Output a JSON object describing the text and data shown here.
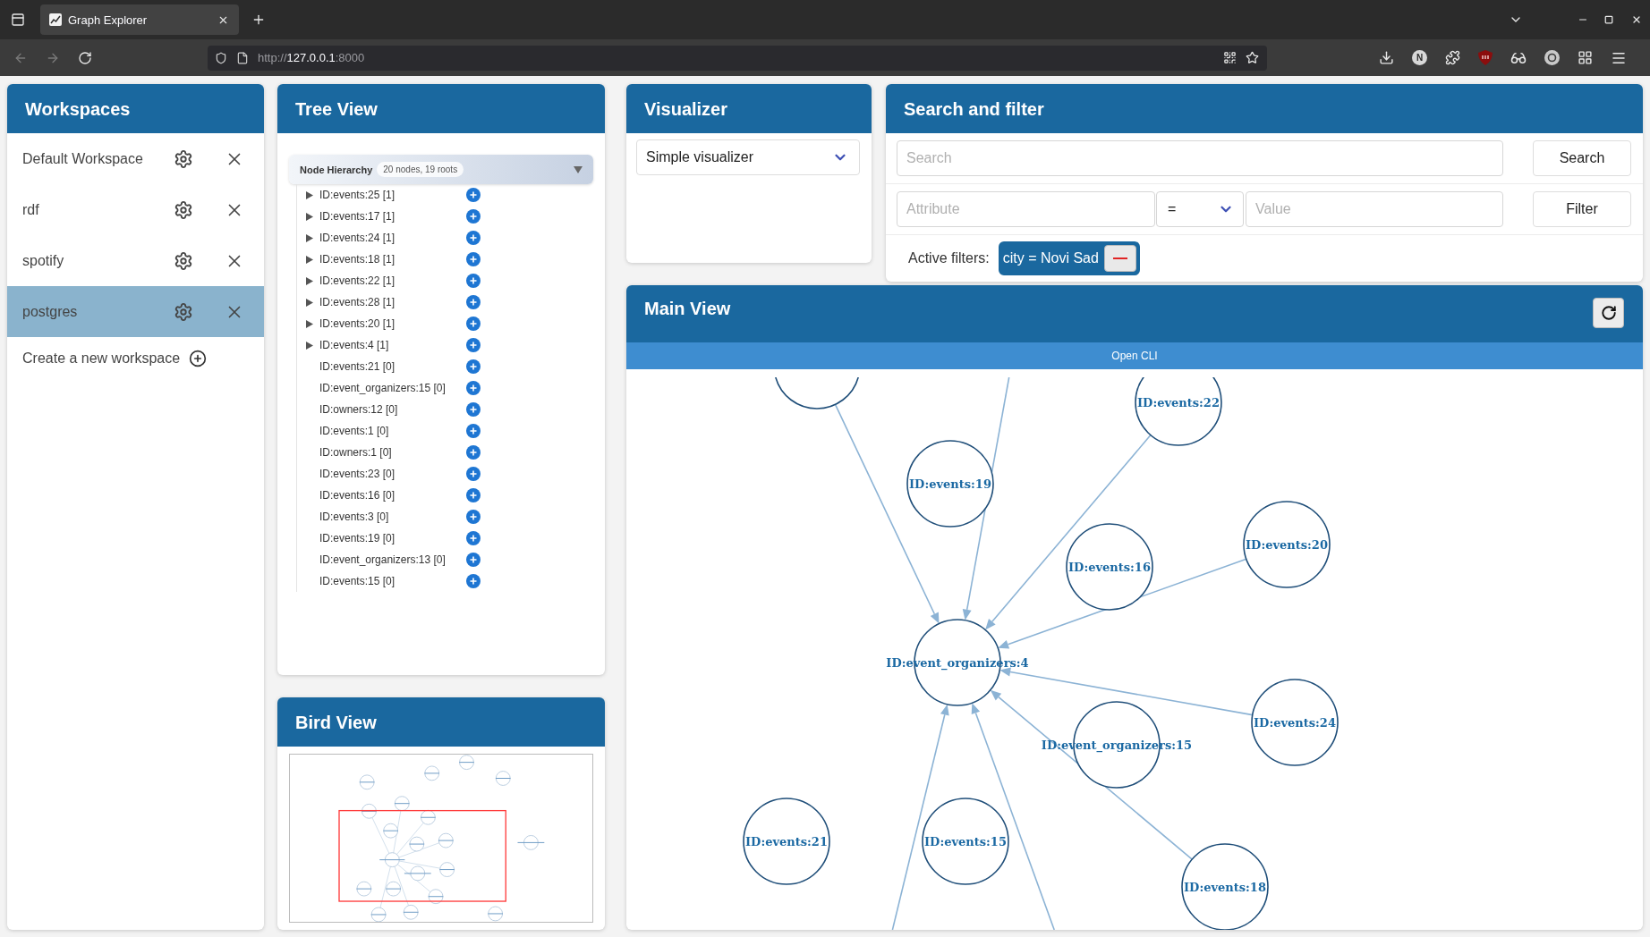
{
  "browser": {
    "tabs": [
      {
        "title": "Graph Explorer",
        "selected": true
      }
    ],
    "url": "http://**127.0.0.1**:8000",
    "extension_letter": "N"
  },
  "workspaces": {
    "title": "Workspaces",
    "items": [
      {
        "name": "Default Workspace",
        "selected": false
      },
      {
        "name": "rdf",
        "selected": false
      },
      {
        "name": "spotify",
        "selected": false
      },
      {
        "name": "postgres",
        "selected": true
      }
    ],
    "create_label": "Create a new workspace"
  },
  "tree_view": {
    "title": "Tree View",
    "hierarchy_title": "Node Hierarchy",
    "hierarchy_badge": "20 nodes, 19 roots",
    "items": [
      {
        "label": "ID:events:25 [1]",
        "expandable": true
      },
      {
        "label": "ID:events:17 [1]",
        "expandable": true
      },
      {
        "label": "ID:events:24 [1]",
        "expandable": true
      },
      {
        "label": "ID:events:18 [1]",
        "expandable": true
      },
      {
        "label": "ID:events:22 [1]",
        "expandable": true
      },
      {
        "label": "ID:events:28 [1]",
        "expandable": true
      },
      {
        "label": "ID:events:20 [1]",
        "expandable": true
      },
      {
        "label": "ID:events:4 [1]",
        "expandable": true
      },
      {
        "label": "ID:events:21 [0]",
        "expandable": false
      },
      {
        "label": "ID:event_organizers:15 [0]",
        "expandable": false
      },
      {
        "label": "ID:owners:12 [0]",
        "expandable": false
      },
      {
        "label": "ID:events:1 [0]",
        "expandable": false
      },
      {
        "label": "ID:owners:1 [0]",
        "expandable": false
      },
      {
        "label": "ID:events:23 [0]",
        "expandable": false
      },
      {
        "label": "ID:events:16 [0]",
        "expandable": false
      },
      {
        "label": "ID:events:3 [0]",
        "expandable": false
      },
      {
        "label": "ID:events:19 [0]",
        "expandable": false
      },
      {
        "label": "ID:event_organizers:13 [0]",
        "expandable": false
      },
      {
        "label": "ID:events:15 [0]",
        "expandable": false
      }
    ]
  },
  "bird_view": {
    "title": "Bird View"
  },
  "visualizer": {
    "title": "Visualizer",
    "value": "Simple visualizer"
  },
  "search_filter": {
    "title": "Search and filter",
    "search": {
      "placeholder": "Search"
    },
    "search_button": "Search",
    "attribute": {
      "placeholder": "Attribute"
    },
    "operator": "=",
    "value": {
      "placeholder": "Value"
    },
    "filter_button": "Filter",
    "active_filters_label": "Active filters:",
    "active_filters": [
      "city = Novi Sad"
    ]
  },
  "main_view": {
    "title": "Main View",
    "cli_button": "Open CLI",
    "graph": {
      "nodes": [
        {
          "label": "ID:events:22"
        },
        {
          "label": "ID:events:19"
        },
        {
          "label": "ID:events:20"
        },
        {
          "label": "ID:events:16"
        },
        {
          "label": "ID:event_organizers:4"
        },
        {
          "label": "ID:events:24"
        },
        {
          "label": "ID:event_organizers:15"
        },
        {
          "label": "ID:events:21"
        },
        {
          "label": "ID:events:15"
        },
        {
          "label": "ID:events:18"
        }
      ]
    }
  }
}
